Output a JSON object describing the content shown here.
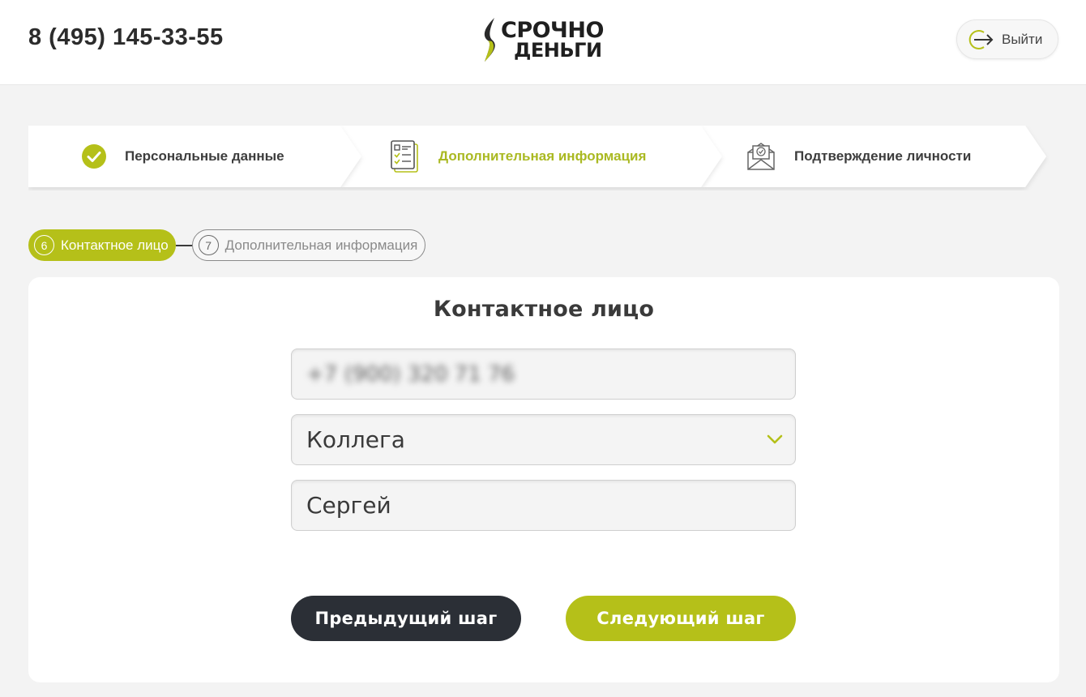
{
  "header": {
    "phone": "8 (495) 145-33-55",
    "logo_line1": "СРОЧНО",
    "logo_line2": "ДЕНЬГИ",
    "logout_label": "Выйти"
  },
  "steps": [
    {
      "label": "Персональные данные",
      "icon": "check-circle-icon",
      "state": "done"
    },
    {
      "label": "Дополнительная информация",
      "icon": "document-checklist-icon",
      "state": "active"
    },
    {
      "label": "Подтверждение личности",
      "icon": "envelope-check-icon",
      "state": "pending"
    }
  ],
  "substeps": [
    {
      "number": "6",
      "label": "Контактное лицо",
      "state": "active"
    },
    {
      "number": "7",
      "label": "Дополнительная информация",
      "state": "pending"
    }
  ],
  "form": {
    "title": "Контактное лицо",
    "phone_value": "+7 (900) 320 71 76",
    "relation_value": "Коллега",
    "name_value": "Сергей"
  },
  "buttons": {
    "prev": "Предыдущий шаг",
    "next": "Следующий шаг"
  },
  "colors": {
    "accent": "#b5c019",
    "dark_button": "#2b2f36",
    "background": "#f3f3f3"
  }
}
